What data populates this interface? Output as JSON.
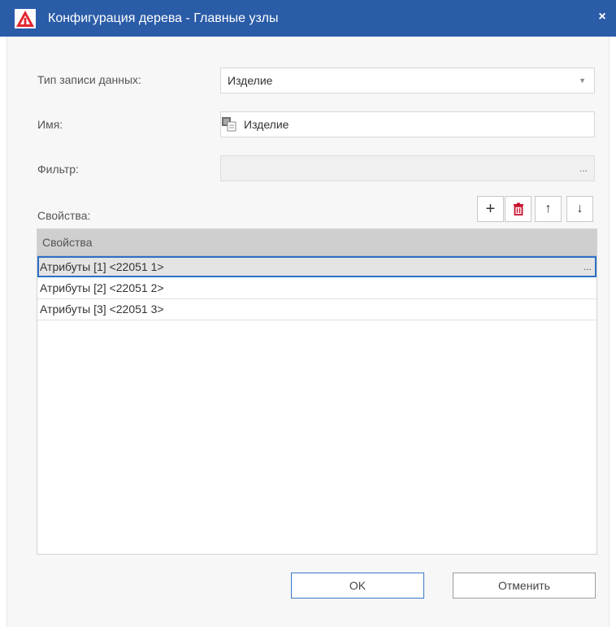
{
  "window": {
    "title": "Конфигурация дерева - Главные узлы",
    "close_label": "×"
  },
  "form": {
    "record_type": {
      "label": "Тип записи данных:",
      "value": "Изделие"
    },
    "name": {
      "label": "Имя:",
      "value": "Изделие"
    },
    "filter": {
      "label": "Фильтр:",
      "value": "",
      "browse_label": "..."
    }
  },
  "properties": {
    "label": "Свойства:",
    "toolbar": {
      "add": "+",
      "up": "↑",
      "down": "↓"
    },
    "grid": {
      "column_header": "Свойства",
      "rows": [
        {
          "text": "Атрибуты [1] <22051 1>",
          "selected": true,
          "ellipsis": "..."
        },
        {
          "text": "Атрибуты [2] <22051 2>",
          "selected": false
        },
        {
          "text": "Атрибуты [3] <22051 3>",
          "selected": false
        }
      ]
    }
  },
  "buttons": {
    "ok": "OK",
    "cancel": "Отменить"
  },
  "colors": {
    "titlebar": "#2b5ca8",
    "selection_border": "#2b6fc6",
    "logo_red": "#e3262d",
    "delete_red": "#c8102e"
  }
}
